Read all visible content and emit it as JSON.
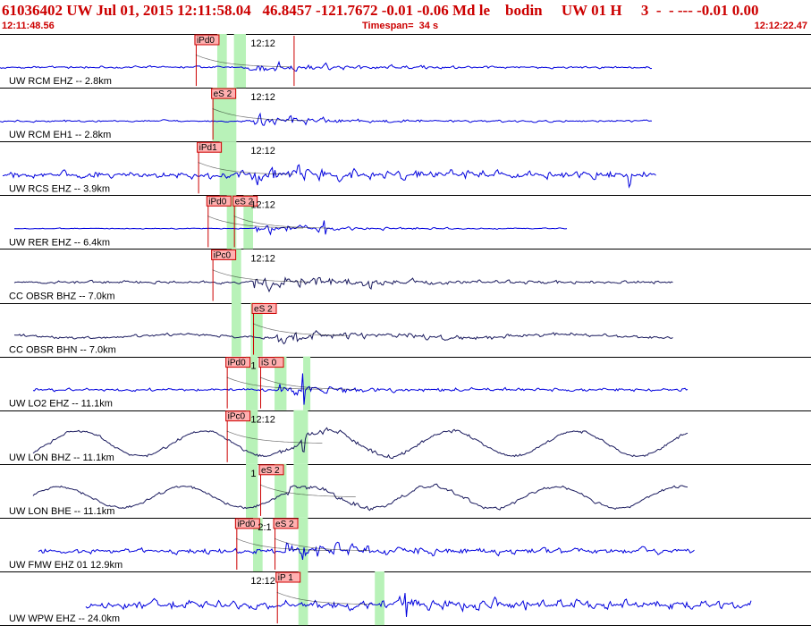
{
  "header": {
    "title": "61036402 UW Jul 01, 2015 12:11:58.04   46.8457 -121.7672 -0.01 -0.06 Md le    bodin     UW 01 H     3  -  - --- -0.01 0.00",
    "start_time": "12:11:48.56",
    "timespan": "Timespan=  34 s",
    "end_time": "12:12:22.47"
  },
  "chart_data": {
    "type": "line",
    "title": "61036402 UW Jul 01, 2015 12:11:58.04",
    "xlim_seconds": [
      0,
      34
    ],
    "grid": false,
    "colors": {
      "blue_trace": "#0000dd",
      "dark_trace": "#1a1a5e",
      "pick": "#cc0000",
      "pick_fill": "#ffb0b0",
      "window": "#b8f2b8"
    },
    "series": [
      {
        "name": "UW RCM EHZ -- 2.8km",
        "color": "#0000dd",
        "start": 0,
        "end": 27.3,
        "amp": 2.5,
        "event": 10.4,
        "peak": 11,
        "decay": 3.0,
        "drift": 0,
        "drift_period": 0,
        "spikes": [],
        "windows": [
          [
            9.1,
            9.5
          ],
          [
            9.8,
            10.3
          ]
        ],
        "picks": [
          {
            "label": "iPd0",
            "t": 8.2,
            "tail": 3
          },
          {
            "label": "",
            "t": 12.3,
            "tail": 0
          }
        ],
        "time_label": "12:12",
        "time_label_t": 10.5
      },
      {
        "name": "UW RCM EH1 -- 2.8km",
        "color": "#0000dd",
        "start": 0,
        "end": 27.3,
        "amp": 2,
        "event": 10.4,
        "peak": 15,
        "decay": 2.5,
        "drift": 0,
        "drift_period": 0,
        "spikes": [],
        "windows": [
          [
            8.9,
            9.9
          ]
        ],
        "picks": [
          {
            "label": "eS 2",
            "t": 8.9,
            "tail": 3
          }
        ],
        "time_label": "12:12",
        "time_label_t": 10.5
      },
      {
        "name": "UW RCS EHZ -- 3.9km",
        "color": "#0000dd",
        "start": 0.1,
        "end": 27.5,
        "amp": 8,
        "event": 10.4,
        "peak": 12,
        "decay": 2.5,
        "drift": 0,
        "drift_period": 0,
        "spikes": [
          [
            26.4,
            14
          ],
          [
            12.5,
            10
          ]
        ],
        "windows": [
          [
            9.2,
            9.9
          ]
        ],
        "picks": [
          {
            "label": "iPd1",
            "t": 8.3,
            "tail": 3
          }
        ],
        "time_label": "12:12",
        "time_label_t": 10.5
      },
      {
        "name": "UW RER EHZ -- 6.4km",
        "color": "#0000dd",
        "start": 0.6,
        "end": 23.8,
        "amp": 1,
        "event": 10.6,
        "peak": 11,
        "decay": 3.0,
        "drift": 0,
        "drift_period": 0,
        "spikes": [
          [
            13.6,
            7
          ]
        ],
        "windows": [
          [
            9.5,
            9.9
          ],
          [
            10.2,
            10.6
          ]
        ],
        "picks": [
          {
            "label": "iPd0",
            "t": 8.7,
            "tail": 3
          },
          {
            "label": "eS 2",
            "t": 9.8,
            "tail": 3
          }
        ],
        "time_label": "12:12",
        "time_label_t": 10.5
      },
      {
        "name": "CC OBSR BHZ -- 7.0km",
        "color": "#1a1a5e",
        "start": 0.6,
        "end": 28.2,
        "amp": 3,
        "event": 10.6,
        "peak": 16,
        "decay": 4.0,
        "drift": 0,
        "drift_period": 0,
        "spikes": [
          [
            15.5,
            8
          ]
        ],
        "windows": [
          [
            9.7,
            10.1
          ]
        ],
        "picks": [
          {
            "label": "iPc0",
            "t": 8.9,
            "tail": 3
          }
        ],
        "time_label": "12:12",
        "time_label_t": 10.5
      },
      {
        "name": "CC OBSR BHN -- 7.0km",
        "color": "#1a1a5e",
        "start": 0.6,
        "end": 28.2,
        "amp": 3,
        "event": 11.5,
        "peak": 14,
        "decay": 4.0,
        "drift": 2,
        "drift_period": 8,
        "spikes": [],
        "windows": [
          [
            9.7,
            10.1
          ],
          [
            10.5,
            11.0
          ]
        ],
        "picks": [
          {
            "label": "eS 2",
            "t": 10.6,
            "tail": 3
          }
        ],
        "time_label": "",
        "time_label_t": 0
      },
      {
        "name": "UW LO2 EHZ -- 11.1km",
        "color": "#0000dd",
        "start": 1.4,
        "end": 28.8,
        "amp": 3,
        "event": 11.7,
        "peak": 9,
        "decay": 3.5,
        "drift": 0,
        "drift_period": 0,
        "spikes": [
          [
            12.7,
            18
          ]
        ],
        "windows": [
          [
            10.3,
            10.8
          ],
          [
            11.5,
            12.0
          ],
          [
            12.7,
            13.0
          ]
        ],
        "picks": [
          {
            "label": "iPd0",
            "t": 9.5,
            "tail": 3
          },
          {
            "label": "iS 0",
            "t": 10.9,
            "tail": 3
          }
        ],
        "time_label": "1",
        "time_label_t": 10.5
      },
      {
        "name": "UW LON BHZ -- 11.1km",
        "color": "#1a1a5e",
        "start": 1.4,
        "end": 28.8,
        "amp": 3,
        "event": 11.7,
        "peak": 6,
        "decay": 3.5,
        "drift": 14,
        "drift_period": 5.2,
        "spikes": [
          [
            12.7,
            14
          ]
        ],
        "windows": [
          [
            10.3,
            10.8
          ],
          [
            12.3,
            12.9
          ]
        ],
        "picks": [
          {
            "label": "iPc0",
            "t": 9.5,
            "tail": 3
          }
        ],
        "time_label": "12:12",
        "time_label_t": 10.5
      },
      {
        "name": "UW LON BHE -- 11.1km",
        "color": "#1a1a5e",
        "start": 1.4,
        "end": 28.8,
        "amp": 3,
        "event": 11.8,
        "peak": 6,
        "decay": 3.5,
        "drift": 12,
        "drift_period": 5.2,
        "spikes": [],
        "windows": [
          [
            10.3,
            10.8
          ],
          [
            11.5,
            12.0
          ],
          [
            12.3,
            12.9
          ]
        ],
        "picks": [
          {
            "label": "eS 2",
            "t": 10.9,
            "tail": 3
          }
        ],
        "time_label": "1",
        "time_label_t": 10.5
      },
      {
        "name": "UW FMW EHZ 01 12.9km",
        "color": "#0000dd",
        "start": 1.6,
        "end": 29.1,
        "amp": 6,
        "event": 12.0,
        "peak": 14,
        "decay": 3.0,
        "drift": 0,
        "drift_period": 0,
        "spikes": [
          [
            13.3,
            10
          ]
        ],
        "windows": [
          [
            10.6,
            11.0
          ],
          [
            12.5,
            12.9
          ]
        ],
        "picks": [
          {
            "label": "iPd0",
            "t": 9.9,
            "tail": 3
          },
          {
            "label": "eS 2",
            "t": 11.5,
            "tail": 3
          }
        ],
        "time_label": "2:1",
        "time_label_t": 10.8
      },
      {
        "name": "UW WPW EHZ -- 24.0km",
        "color": "#0000dd",
        "start": 3.6,
        "end": 31.5,
        "amp": 9,
        "event": 16.6,
        "peak": 8,
        "decay": 3.0,
        "drift": 0,
        "drift_period": 0,
        "spikes": [
          [
            17.0,
            14
          ]
        ],
        "windows": [
          [
            12.5,
            12.9
          ],
          [
            15.7,
            16.1
          ]
        ],
        "picks": [
          {
            "label": "iP 1",
            "t": 11.6,
            "tail": 3
          }
        ],
        "time_label": "12:12",
        "time_label_t": 10.5
      }
    ]
  }
}
